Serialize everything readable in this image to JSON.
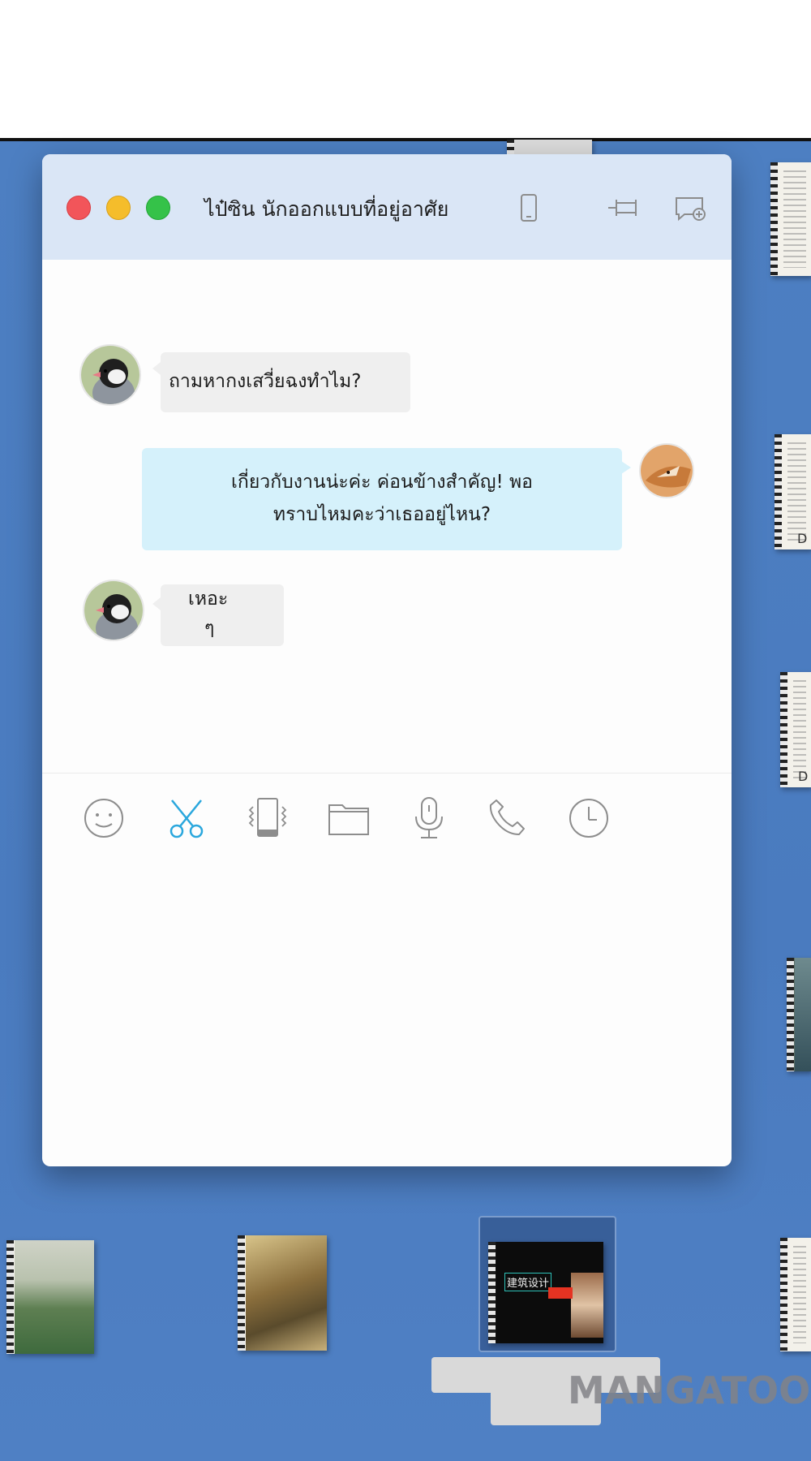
{
  "window": {
    "title": "ไป๋ซิน นักออกแบบที่อยู่อาศัย",
    "controls": [
      "close",
      "minimize",
      "zoom"
    ],
    "title_icons": [
      "phone-icon",
      "pin-icon",
      "add-chat-icon"
    ]
  },
  "messages": [
    {
      "side": "left",
      "sender_avatar": "sparrow-avatar",
      "text_lines": [
        "ถามหากงเสวี่ยฉงทำไม?"
      ]
    },
    {
      "side": "right",
      "sender_avatar": "fox-avatar",
      "text_lines": [
        "เกี่ยวกับงานน่ะค่ะ ค่อนข้างสำคัญ! พอ",
        "ทราบไหมคะว่าเธออยู่ไหน?"
      ]
    },
    {
      "side": "left",
      "sender_avatar": "sparrow-avatar",
      "text_lines": [
        "เหอะ",
        "ๆ"
      ]
    }
  ],
  "toolbar": {
    "icons": [
      "emoji-icon",
      "scissors-icon",
      "vibrate-icon",
      "folder-icon",
      "microphone-icon",
      "phone-call-icon",
      "history-icon"
    ],
    "accent_color": "#2aa7dd"
  },
  "desktop": {
    "file_labels": [
      "D",
      "D"
    ],
    "selected_file_text": "建筑设计"
  },
  "watermark": "MANGATOON"
}
